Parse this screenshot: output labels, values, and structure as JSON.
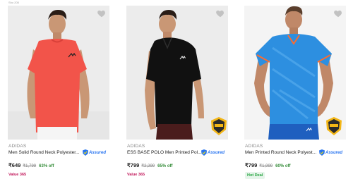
{
  "page": {
    "crumb": "Sho 205"
  },
  "products": [
    {
      "brand": "ADIDAS",
      "title": "Men Solid Round Neck Polyester...",
      "price": "₹649",
      "mrp": "₹1,799",
      "discount": "63% off",
      "tag": "Value 365",
      "assured_label": "Assured",
      "shirt_color": "#f2544a"
    },
    {
      "brand": "ADIDAS",
      "title": "ESS BASE POLO Men Printed Pol...",
      "price": "₹799",
      "mrp": "₹2,299",
      "discount": "65% off",
      "tag": "Value 365",
      "assured_label": "Assured",
      "shirt_color": "#1a1a1a"
    },
    {
      "brand": "ADIDAS",
      "title": "Men Printed Round Neck Polyest...",
      "price": "₹799",
      "mrp": "₹1,999",
      "discount": "60% off",
      "tag": "Hot Deal",
      "assured_label": "Assured",
      "shirt_color": "#2d8fe0"
    }
  ],
  "icons": {
    "wishlist": "heart-icon",
    "assured": "flipkart-assured-icon",
    "badge": "brand-badge-icon"
  }
}
